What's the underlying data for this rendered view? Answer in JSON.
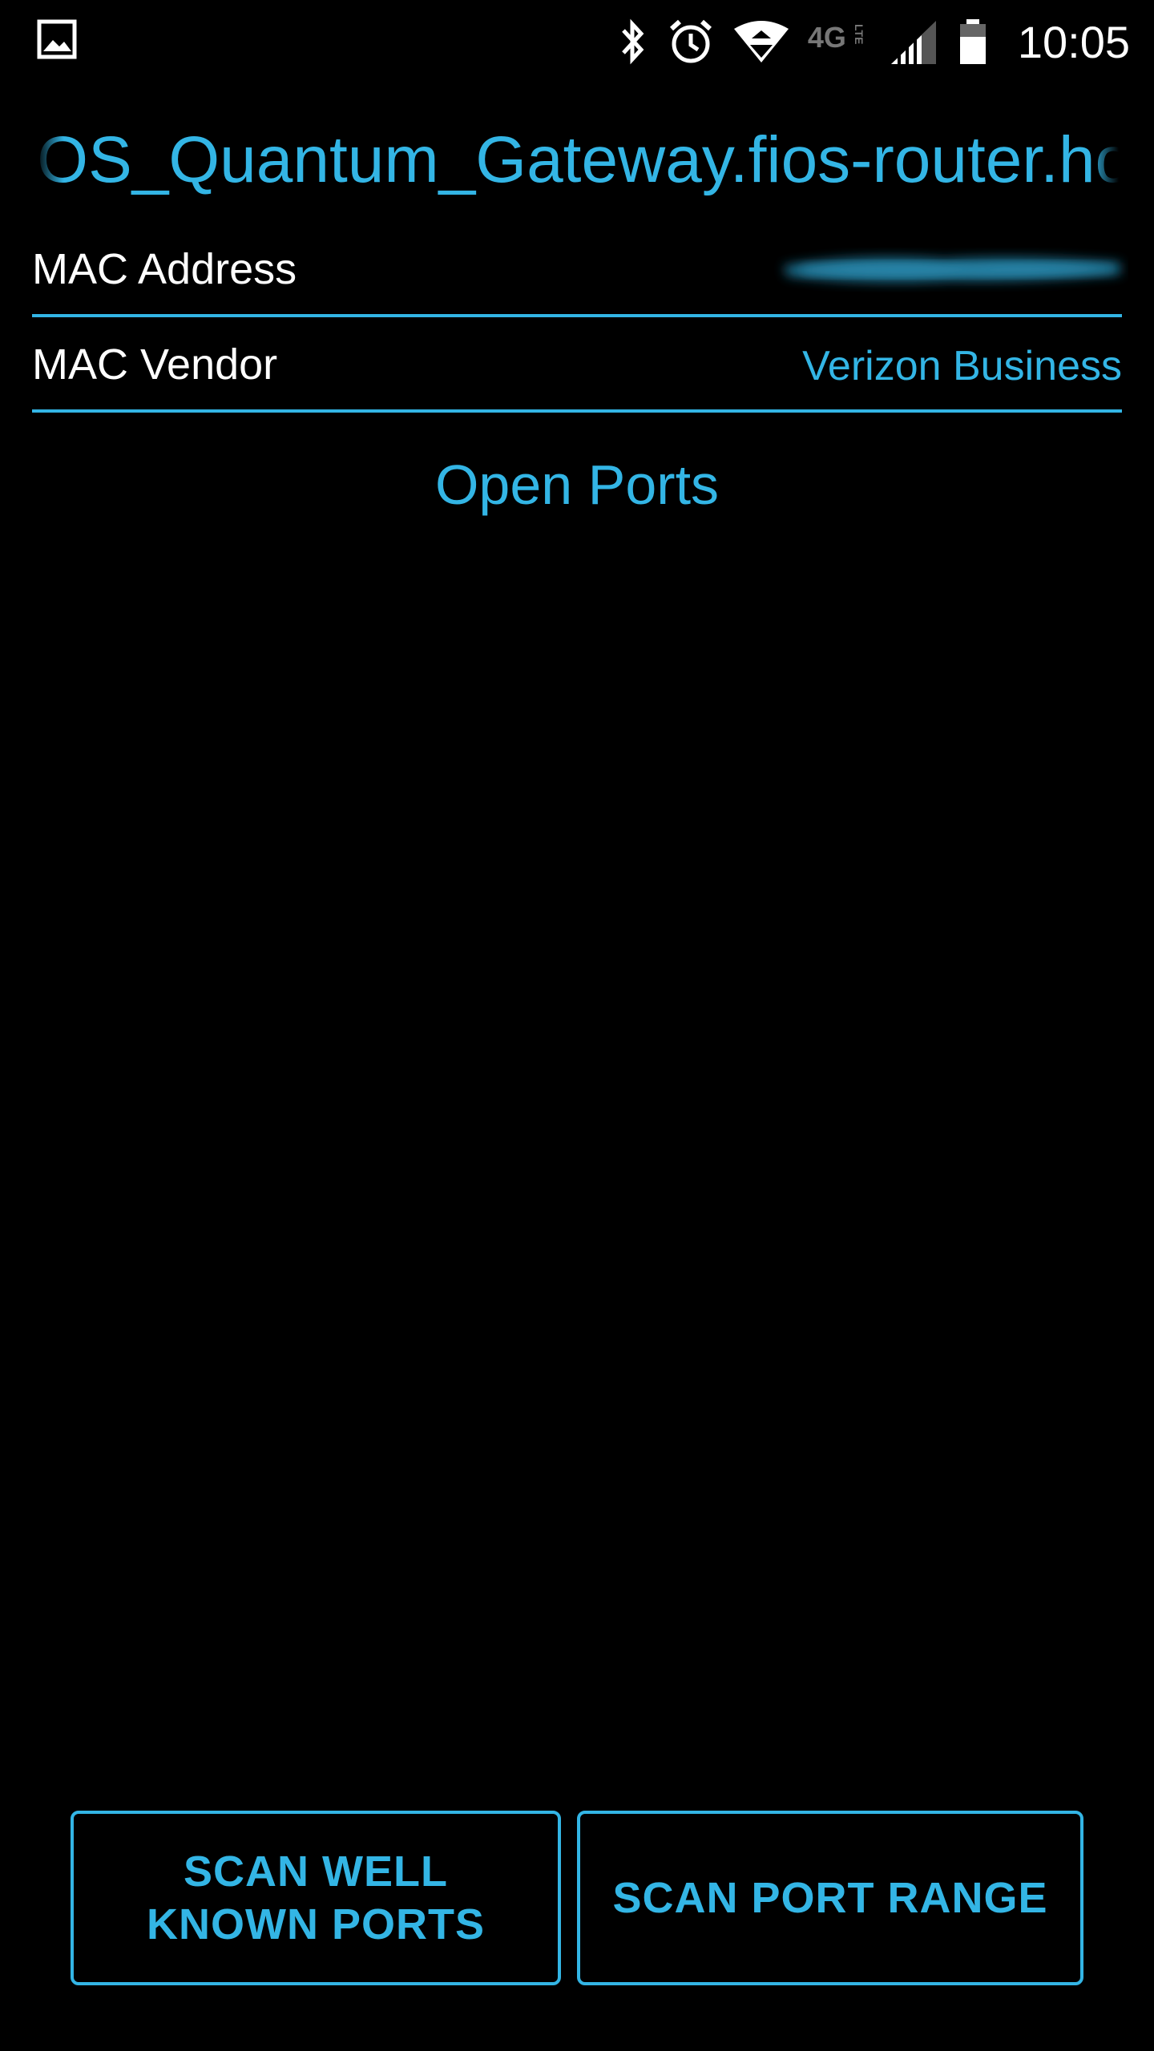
{
  "status_bar": {
    "time": "10:05",
    "icons": [
      "image-notification-icon",
      "bluetooth-icon",
      "alarm-icon",
      "wifi-icon",
      "4g-lte-icon",
      "cell-signal-icon",
      "battery-icon"
    ],
    "network_label": "4G",
    "network_sub_label": "LTE"
  },
  "host": {
    "title": "FiOS_Quantum_Gateway.fios-router.home"
  },
  "details": {
    "mac_address": {
      "label": "MAC Address",
      "value": ""
    },
    "mac_vendor": {
      "label": "MAC Vendor",
      "value": "Verizon Business"
    }
  },
  "open_ports": {
    "title": "Open Ports",
    "items": []
  },
  "actions": {
    "scan_well_known_label": "SCAN WELL KNOWN PORTS",
    "scan_port_range_label": "SCAN PORT RANGE"
  },
  "colors": {
    "accent": "#33b5e5",
    "background": "#000000",
    "text": "#ffffff"
  }
}
